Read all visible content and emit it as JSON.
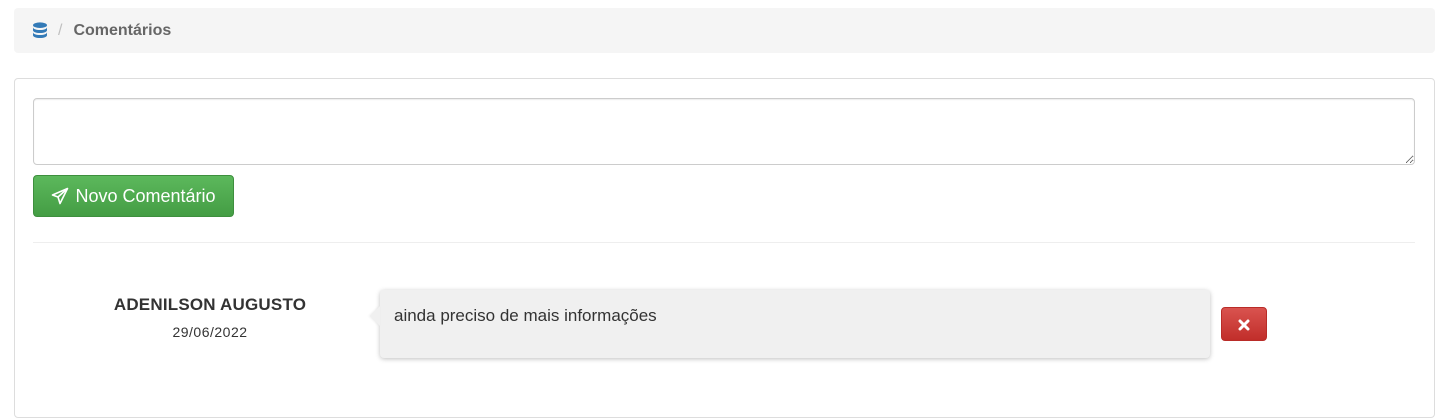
{
  "breadcrumb": {
    "icon": "database-icon",
    "separator": "/",
    "current": "Comentários"
  },
  "comment_form": {
    "input_value": "",
    "submit_label": "Novo Comentário",
    "submit_icon": "paper-plane-icon"
  },
  "comments": [
    {
      "author": "ADENILSON AUGUSTO",
      "date": "29/06/2022",
      "text": "ainda preciso de mais informações",
      "delete_icon": "close-icon"
    }
  ],
  "colors": {
    "icon_blue": "#337ab7",
    "success_green": "#5cb85c",
    "danger_red": "#d9534f"
  }
}
